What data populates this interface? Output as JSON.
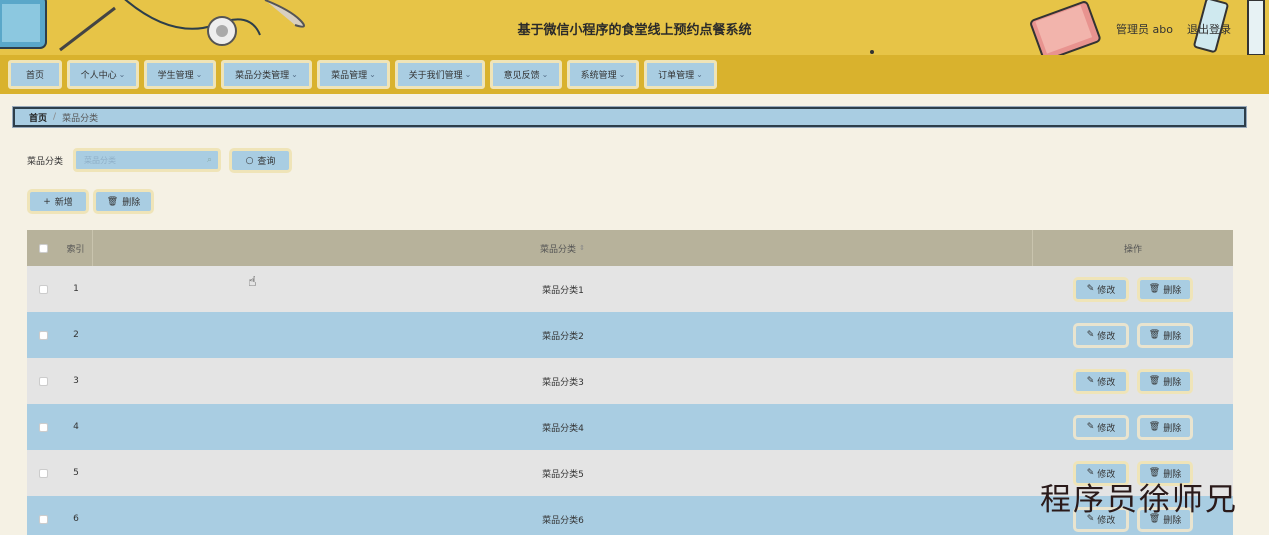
{
  "header": {
    "title": "基于微信小程序的食堂线上预约点餐系统",
    "user": "管理员 abo",
    "logout": "退出登录"
  },
  "nav": {
    "items": [
      {
        "label": "首页",
        "has_dropdown": false
      },
      {
        "label": "个人中心",
        "has_dropdown": true
      },
      {
        "label": "学生管理",
        "has_dropdown": true
      },
      {
        "label": "菜品分类管理",
        "has_dropdown": true
      },
      {
        "label": "菜品管理",
        "has_dropdown": true
      },
      {
        "label": "关于我们管理",
        "has_dropdown": true
      },
      {
        "label": "意见反馈",
        "has_dropdown": true
      },
      {
        "label": "系统管理",
        "has_dropdown": true
      },
      {
        "label": "订单管理",
        "has_dropdown": true
      }
    ]
  },
  "breadcrumb": {
    "home": "首页",
    "separator": "/",
    "current": "菜品分类"
  },
  "search": {
    "label": "菜品分类",
    "placeholder": "菜品分类",
    "button": "查询"
  },
  "actions": {
    "add": "新增",
    "delete": "删除"
  },
  "table": {
    "headers": {
      "index": "索引",
      "name": "菜品分类",
      "operation": "操作"
    },
    "edit_label": "修改",
    "delete_label": "删除",
    "rows": [
      {
        "index": "1",
        "name": "菜品分类1"
      },
      {
        "index": "2",
        "name": "菜品分类2"
      },
      {
        "index": "3",
        "name": "菜品分类3"
      },
      {
        "index": "4",
        "name": "菜品分类4"
      },
      {
        "index": "5",
        "name": "菜品分类5"
      },
      {
        "index": "6",
        "name": "菜品分类6"
      }
    ]
  },
  "watermark": "程序员徐师兄",
  "colors": {
    "header_bg": "#e7c447",
    "nav_bg": "#d9b22d",
    "accent_blue": "#a9cde2",
    "table_head": "#b7b29b",
    "page_bg": "#f5f1e4"
  }
}
